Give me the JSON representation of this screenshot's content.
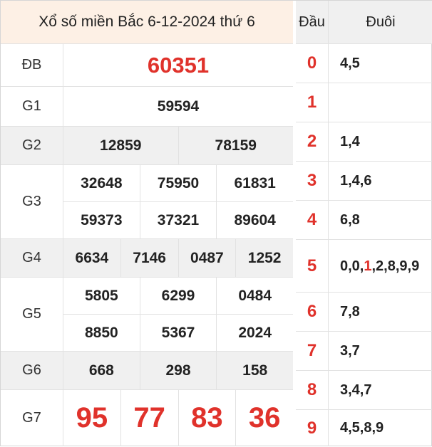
{
  "title": "Xổ số miền Bắc 6-12-2024 thứ 6",
  "prizes": {
    "db": {
      "label": "ĐB",
      "numbers": [
        "60351"
      ]
    },
    "g1": {
      "label": "G1",
      "numbers": [
        "59594"
      ]
    },
    "g2": {
      "label": "G2",
      "numbers": [
        "12859",
        "78159"
      ]
    },
    "g3": {
      "label": "G3",
      "numbers": [
        "32648",
        "75950",
        "61831",
        "59373",
        "37321",
        "89604"
      ]
    },
    "g4": {
      "label": "G4",
      "numbers": [
        "6634",
        "7146",
        "0487",
        "1252"
      ]
    },
    "g5": {
      "label": "G5",
      "numbers": [
        "5805",
        "6299",
        "0484",
        "8850",
        "5367",
        "2024"
      ]
    },
    "g6": {
      "label": "G6",
      "numbers": [
        "668",
        "298",
        "158"
      ]
    },
    "g7": {
      "label": "G7",
      "numbers": [
        "95",
        "77",
        "83",
        "36"
      ]
    }
  },
  "loto": {
    "head_label": "Đầu",
    "tail_label": "Đuôi",
    "rows": [
      {
        "head": "0",
        "tail": "4,5"
      },
      {
        "head": "1",
        "tail": ""
      },
      {
        "head": "2",
        "tail": "1,4"
      },
      {
        "head": "3",
        "tail": "1,4,6"
      },
      {
        "head": "4",
        "tail": "6,8"
      },
      {
        "head": "5",
        "tail_before": "0,0,",
        "tail_highlight": "1",
        "tail_after": ",2,8,9,9"
      },
      {
        "head": "6",
        "tail": "7,8"
      },
      {
        "head": "7",
        "tail": "3,7"
      },
      {
        "head": "8",
        "tail": "3,4,7"
      },
      {
        "head": "9",
        "tail": "4,5,8,9"
      }
    ]
  },
  "colors": {
    "accent": "#e0322b",
    "header_bg": "#fdf0e5",
    "stripe_bg": "#f0f0f0"
  }
}
